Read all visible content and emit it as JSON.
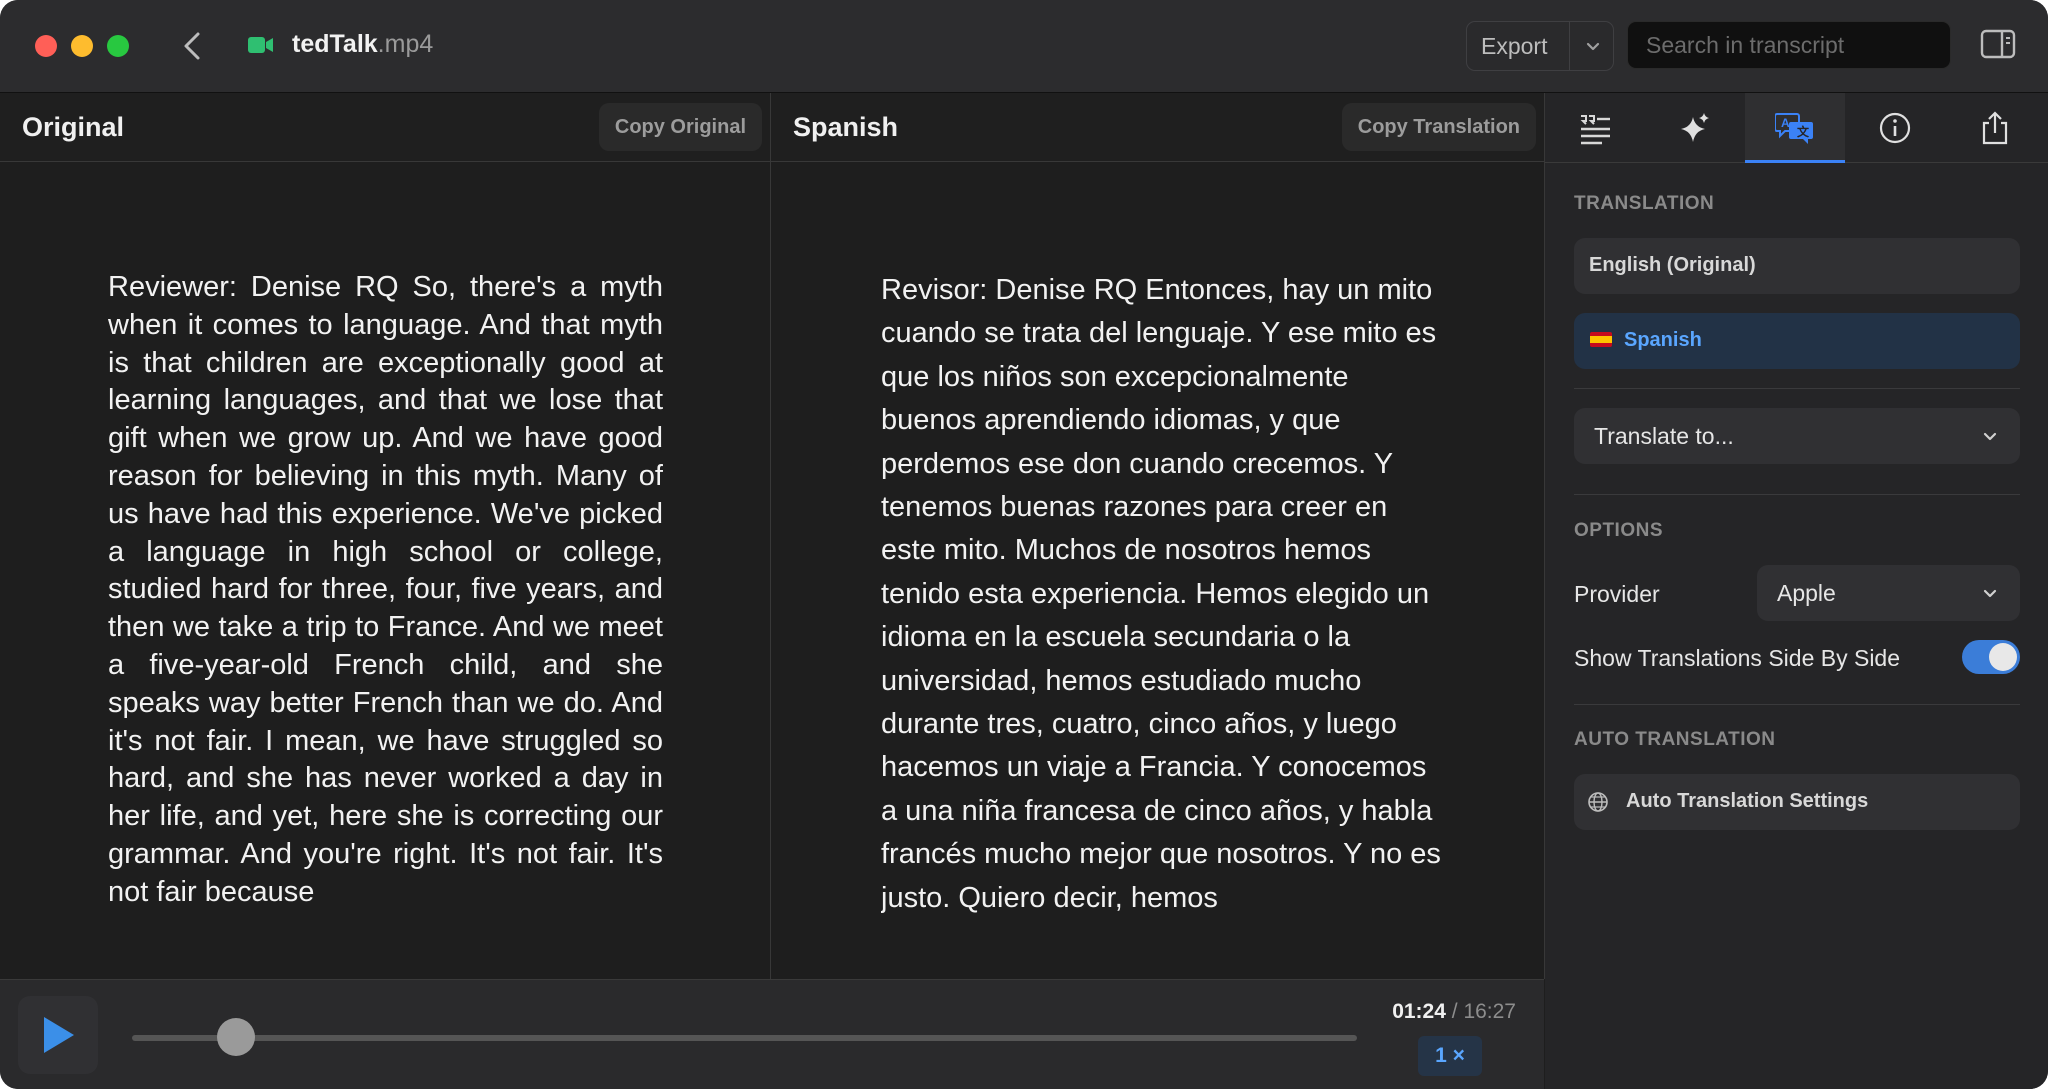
{
  "window": {
    "file_name": "tedTalk",
    "file_ext": ".mp4",
    "export_label": "Export",
    "search_placeholder": "Search in transcript"
  },
  "original": {
    "title": "Original",
    "copy_label": "Copy Original",
    "text": "Reviewer: Denise RQ So, there's a myth when it comes to language. And that myth is that children are exceptionally good at learning languages, and that we lose that gift when we grow up. And we have good reason for believing in this myth. Many of us have had this experience. We've picked a language in high school or college, studied hard for three, four, five years, and then we take a trip to France. And we meet a five-year-old French child, and she speaks way better French than we do. And it's not fair. I mean, we have struggled so hard, and she has never worked a day in her life, and yet, here she is correcting our grammar. And you're right. It's not fair. It's not fair because"
  },
  "translation": {
    "title": "Spanish",
    "copy_label": "Copy Translation",
    "text": "Revisor: Denise RQ Entonces, hay un mito cuando se trata del lenguaje. Y ese mito es que los niños son excepcionalmente buenos aprendiendo idiomas, y que perdemos ese don cuando crecemos. Y tenemos buenas razones para creer en este mito. Muchos de nosotros hemos tenido esta experiencia. Hemos elegido un idioma en la escuela secundaria o la universidad, hemos estudiado mucho durante tres, cuatro, cinco años, y luego hacemos un viaje a Francia. Y conocemos a una niña francesa de cinco años, y habla francés mucho mejor que nosotros. Y no es justo. Quiero decir, hemos"
  },
  "player": {
    "current_time": "01:24",
    "separator": " / ",
    "duration": "16:27",
    "speed": "1 ×",
    "progress_fraction": 0.085
  },
  "inspector": {
    "tabs": [
      "transcript-icon",
      "sparkles-icon",
      "translate-icon",
      "info-icon",
      "share-icon"
    ],
    "active_tab": "translate-icon",
    "translation_section": "TRANSLATION",
    "languages": [
      "English (Original)",
      "Spanish"
    ],
    "selected_language": "Spanish",
    "translate_to_label": "Translate to...",
    "options_section": "OPTIONS",
    "provider_label": "Provider",
    "provider_value": "Apple",
    "side_by_side_label": "Show Translations Side By Side",
    "side_by_side_enabled": true,
    "auto_section": "AUTO TRANSLATION",
    "auto_settings_label": "Auto Translation Settings"
  },
  "colors": {
    "accent": "#3b82f6",
    "close": "#ff5f57",
    "minimize": "#febc2e",
    "zoom": "#28c840",
    "file_icon": "#2fbf71"
  }
}
